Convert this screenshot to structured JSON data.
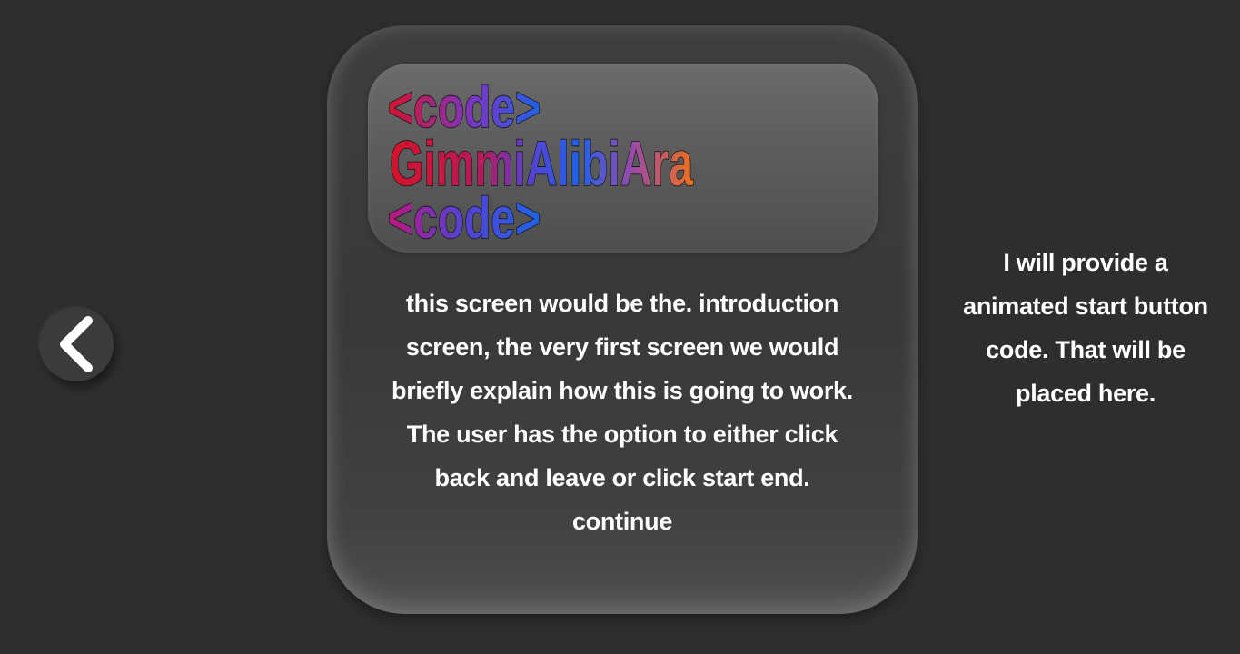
{
  "back_button": {
    "icon": "chevron-left-icon"
  },
  "logo": {
    "line1": "<code>",
    "line2_parts": [
      "Gimmi",
      "Alibi",
      "Ara"
    ],
    "line3": "<code>",
    "colors": {
      "red": "#d4132a",
      "purple": "#7b35c4",
      "blue": "#1e62e8",
      "orange": "#f0701c"
    }
  },
  "card": {
    "description": "this screen would be the. introduction screen, the very first screen we would briefly explain how this is going to work. The user has the option to either click back and leave or click start end. continue"
  },
  "side_note": {
    "text": "I will provide a animated start button code. That will be placed here."
  },
  "colors": {
    "background": "#2e2e2e",
    "text": "#ffffff"
  }
}
